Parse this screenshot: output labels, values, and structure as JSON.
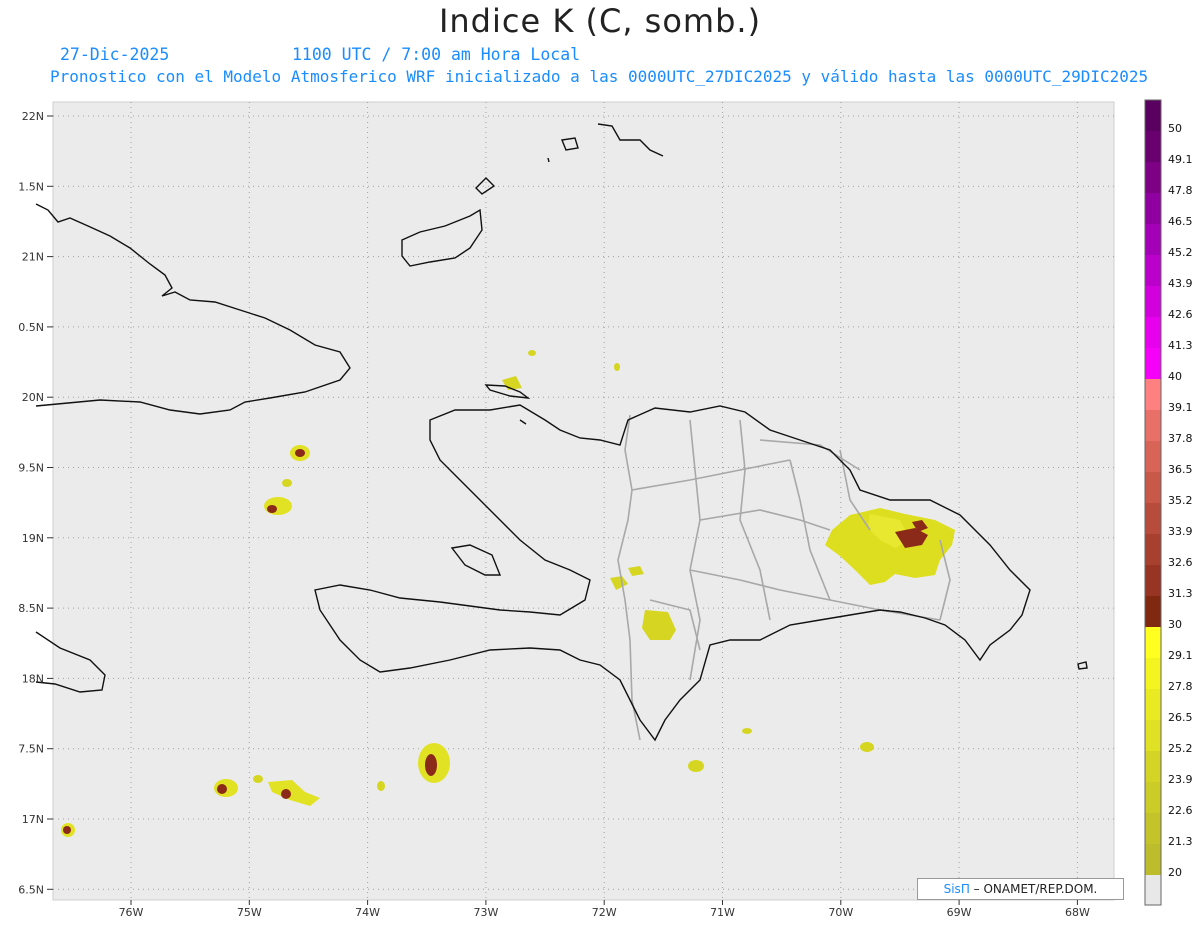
{
  "header": {
    "title": "Indice K (C, somb.)",
    "date": "27-Dic-2025",
    "time": "1100 UTC / 7:00 am Hora Local",
    "description": "Pronostico con el Modelo Atmosferico WRF inicializado a las 0000UTC_27DIC2025 y válido hasta las  0000UTC_29DIC2025"
  },
  "axes": {
    "lat_labels": [
      "22N",
      "1.5N",
      "21N",
      "0.5N",
      "20N",
      "9.5N",
      "19N",
      "8.5N",
      "18N",
      "7.5N",
      "17N",
      "6.5N"
    ],
    "lon_labels": [
      "76W",
      "75W",
      "74W",
      "73W",
      "72W",
      "71W",
      "70W",
      "69W",
      "68W"
    ]
  },
  "colorbar": {
    "labels": [
      "50",
      "49.1",
      "47.8",
      "46.5",
      "45.2",
      "43.9",
      "42.6",
      "41.3",
      "40",
      "39.1",
      "37.8",
      "36.5",
      "35.2",
      "33.9",
      "32.6",
      "31.3",
      "30",
      "29.1",
      "27.8",
      "26.5",
      "25.2",
      "23.9",
      "22.6",
      "21.3",
      "20"
    ],
    "colors": [
      "#5a0060",
      "#6a0070",
      "#7d0085",
      "#9000a0",
      "#a400b8",
      "#bb00cc",
      "#d200dd",
      "#e600ee",
      "#f500f8",
      "#ff8080",
      "#e87068",
      "#d86458",
      "#c85848",
      "#b84c3c",
      "#a84030",
      "#983424",
      "#802810",
      "#ffff20",
      "#f4f420",
      "#eaea22",
      "#e0e024",
      "#d4d426",
      "#cccc28",
      "#c4c42a",
      "#bcbc2c"
    ],
    "base_color": "#e8e8e8"
  },
  "credit": {
    "brand": "SisΠ",
    "text": " – ONAMET/REP.DOM."
  },
  "colors": {
    "map_bg": "#ebebeb",
    "coast": "#111111",
    "borders": "#a8a8a8",
    "k_low": "#dede20",
    "k_high": "#8b2a18"
  }
}
